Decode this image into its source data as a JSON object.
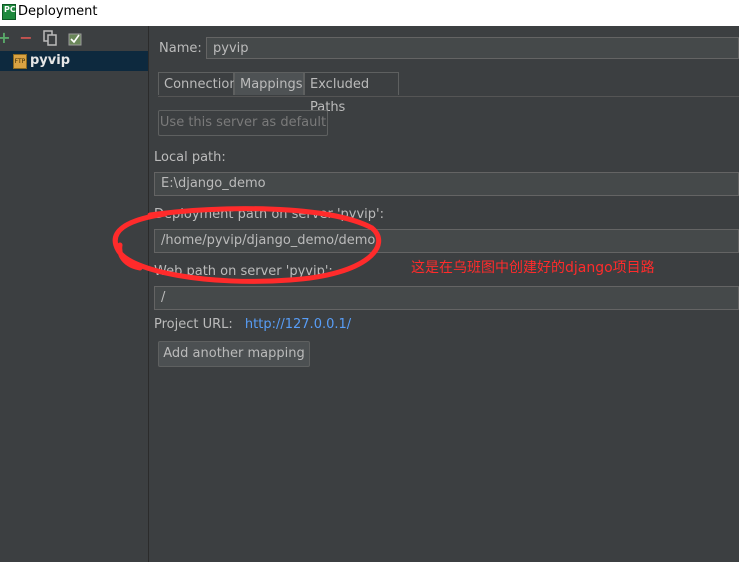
{
  "window": {
    "title": "Deployment",
    "app_icon_text": "PC"
  },
  "toolbar": {
    "add": "+",
    "remove": "−",
    "copy": "⧉",
    "check": "✓"
  },
  "sidebar": {
    "server_name": "pyvip",
    "server_icon_text": "FTP"
  },
  "form": {
    "name_label": "Name:",
    "name_value": "pyvip",
    "tabs": [
      "Connection",
      "Mappings",
      "Excluded Paths"
    ],
    "use_default_button": "Use this server as default",
    "local_path_label": "Local path:",
    "local_path_value": "E:\\django_demo",
    "deployment_path_label": "Deployment path on server 'pyvip':",
    "deployment_path_value": "/home/pyvip/django_demo/demo",
    "web_path_label": "Web path on server 'pyvip':",
    "web_path_value": "/",
    "project_url_label": "Project URL:",
    "project_url_value": "http://127.0.0.1/",
    "add_mapping_button": "Add another mapping"
  },
  "annotation": {
    "text": "这是在乌班图中创建好的django项目路",
    "color": "#ff2b2b"
  },
  "colors": {
    "accent": "#589df6",
    "selection": "#0d293e",
    "panel": "#3c3f41"
  }
}
